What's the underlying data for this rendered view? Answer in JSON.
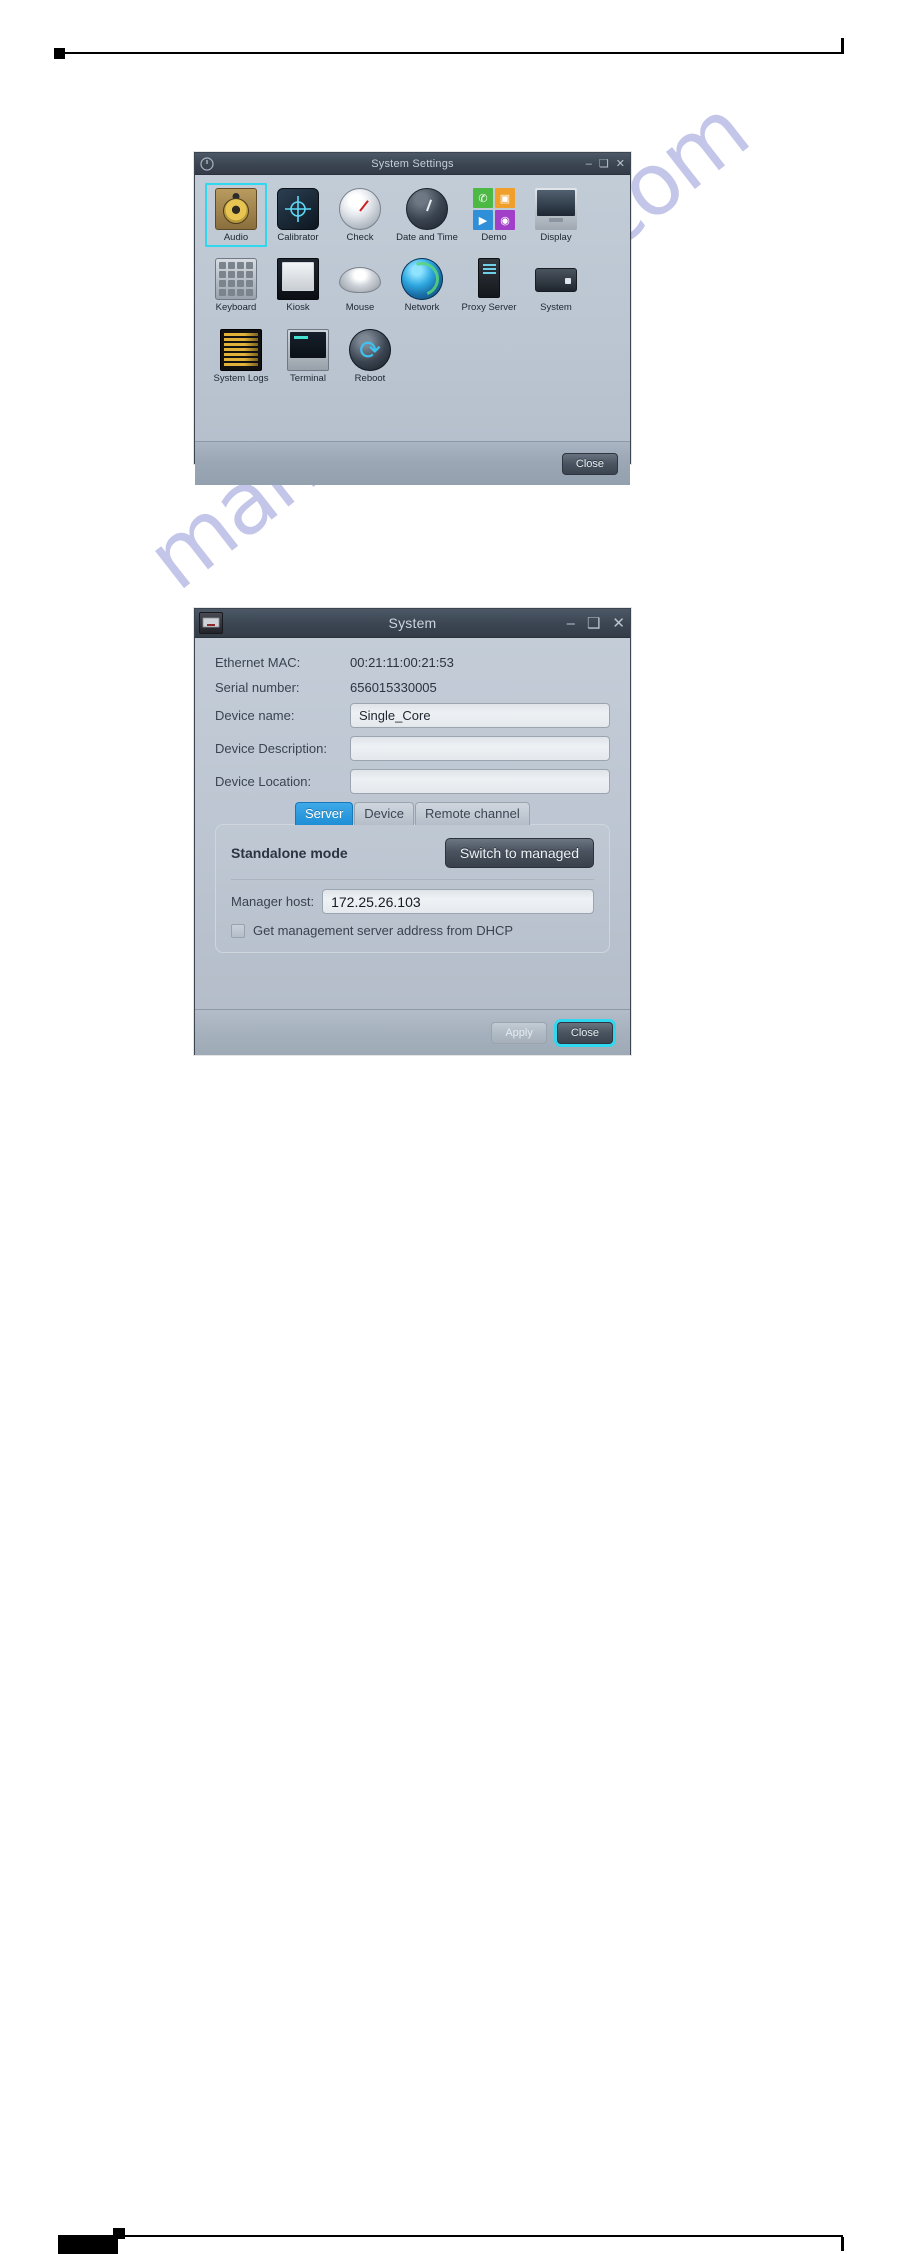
{
  "page": {
    "header_mark": "black-square-mark",
    "footer_mark": "redacted-page-number"
  },
  "watermark": {
    "text": "manualshive.com"
  },
  "settings_window": {
    "title": "System Settings",
    "titlebar_icon": "power-settings-icon",
    "window_buttons": {
      "minimize": "–",
      "maximize": "❑",
      "close": "✕"
    },
    "close_label": "Close",
    "icons": [
      {
        "label": "Audio",
        "icon": "speaker-icon",
        "selected": true
      },
      {
        "label": "Calibrator",
        "icon": "crosshair-icon",
        "selected": false
      },
      {
        "label": "Check",
        "icon": "gauge-icon",
        "selected": false
      },
      {
        "label": "Date and Time",
        "icon": "clock-icon",
        "selected": false
      },
      {
        "label": "Demo",
        "icon": "app-tiles-icon",
        "selected": false
      },
      {
        "label": "Display",
        "icon": "monitor-icon",
        "selected": false
      },
      {
        "label": "Keyboard",
        "icon": "keyboard-icon",
        "selected": false
      },
      {
        "label": "Kiosk",
        "icon": "kiosk-icon",
        "selected": false
      },
      {
        "label": "Mouse",
        "icon": "mouse-icon",
        "selected": false
      },
      {
        "label": "Network",
        "icon": "globe-icon",
        "selected": false
      },
      {
        "label": "Proxy Server",
        "icon": "server-tower-icon",
        "selected": false
      },
      {
        "label": "System",
        "icon": "device-box-icon",
        "selected": false
      },
      {
        "label": "System Logs",
        "icon": "log-list-icon",
        "selected": false
      },
      {
        "label": "Terminal",
        "icon": "terminal-icon",
        "selected": false
      },
      {
        "label": "Reboot",
        "icon": "refresh-circle-icon",
        "selected": false
      }
    ]
  },
  "system_window": {
    "title": "System",
    "titlebar_icon": "keyboard-device-icon",
    "window_buttons": {
      "minimize": "–",
      "maximize": "❑",
      "close": "✕"
    },
    "fields": {
      "mac_label": "Ethernet MAC:",
      "mac_value": "00:21:11:00:21:53",
      "serial_label": "Serial number:",
      "serial_value": "656015330005",
      "device_name_label": "Device name:",
      "device_name_value": "Single_Core",
      "device_description_label": "Device Description:",
      "device_description_value": "",
      "device_location_label": "Device Location:",
      "device_location_value": ""
    },
    "tabs": [
      {
        "label": "Server",
        "active": true
      },
      {
        "label": "Device",
        "active": false
      },
      {
        "label": "Remote channel",
        "active": false
      }
    ],
    "server_panel": {
      "mode_title": "Standalone mode",
      "switch_button": "Switch to managed",
      "manager_host_label": "Manager host:",
      "manager_host_value": "172.25.26.103",
      "dhcp_checkbox_label": "Get management server address from DHCP",
      "dhcp_checked": false
    },
    "buttons": {
      "apply_label": "Apply",
      "apply_disabled": true,
      "close_label": "Close",
      "close_focused": true
    }
  },
  "colors": {
    "accent_blue": "#1e8ed6",
    "focus_cyan": "#2fd8ef",
    "titlebar": "#3b4552",
    "window_bg": "#bcc6d2",
    "watermark": "#c3c6e8"
  }
}
